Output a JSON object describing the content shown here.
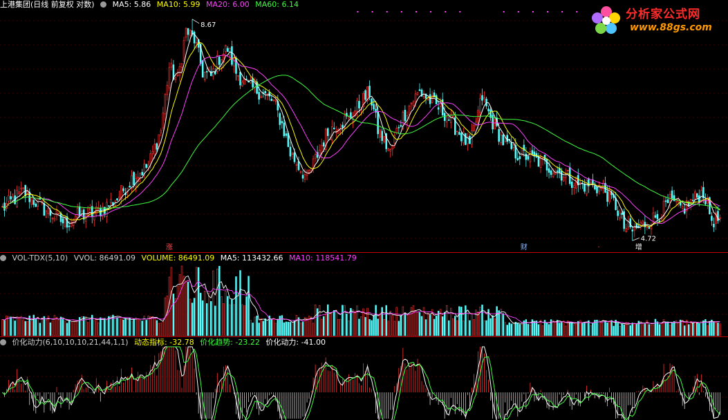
{
  "main": {
    "title": "上港集团(日线 前复权 对数)",
    "ma_labels": [
      {
        "text": "MA5: 5.86",
        "color": "#ffffff"
      },
      {
        "text": "MA10: 5.99",
        "color": "#ffff00"
      },
      {
        "text": "MA20: 6.00",
        "color": "#ff40ff"
      },
      {
        "text": "MA60: 6.14",
        "color": "#40ff40"
      }
    ],
    "high_label": "8.67",
    "low_label": "4.72",
    "markers": [
      {
        "text": "涨",
        "index": 80
      },
      {
        "text": "财",
        "index": 250
      },
      {
        "text": "",
        "index": 287
      },
      {
        "text": "增",
        "index": 305
      }
    ]
  },
  "volume": {
    "indicator": "VOL-TDX(5,10)",
    "labels": [
      {
        "text": "VVOL: 86491.09",
        "color": "#d0d0d0"
      },
      {
        "text": "VOLUME: 86491.09",
        "color": "#ffff00"
      },
      {
        "text": "MA5: 113432.66",
        "color": "#ffffff"
      },
      {
        "text": "MA10: 118541.79",
        "color": "#ff40ff"
      }
    ]
  },
  "momentum": {
    "indicator": "价化动力(6,10,10,10,21,44,1,1)",
    "labels": [
      {
        "text": "动态指标: -32.78",
        "color": "#ffff00"
      },
      {
        "text": "价化趋势: -23.22",
        "color": "#40ff40"
      },
      {
        "text": "价化动力: -41.00",
        "color": "#ffffff"
      }
    ]
  },
  "logo": {
    "name": "分析家公式网",
    "url": "www.88gs.com"
  },
  "colors": {
    "up": "#ff3232",
    "down": "#54fcfc",
    "ma5": "#ffffff",
    "ma10": "#ffff00",
    "ma20": "#ff40ff",
    "ma60": "#40ff40",
    "grid": "#8b0000"
  },
  "chart_data": {
    "type": "candlestick",
    "bars": 345,
    "price_range": [
      4.6,
      8.9
    ],
    "scale": "log",
    "price_anchors": [
      [
        0,
        5.15
      ],
      [
        10,
        5.4
      ],
      [
        20,
        5.15
      ],
      [
        30,
        4.95
      ],
      [
        35,
        5.05
      ],
      [
        45,
        5.1
      ],
      [
        55,
        5.3
      ],
      [
        62,
        5.6
      ],
      [
        70,
        5.8
      ],
      [
        76,
        6.4
      ],
      [
        80,
        7.6
      ],
      [
        84,
        7.3
      ],
      [
        88,
        8.4
      ],
      [
        92,
        8.2
      ],
      [
        96,
        7.5
      ],
      [
        100,
        7.4
      ],
      [
        104,
        7.8
      ],
      [
        108,
        8.0
      ],
      [
        112,
        7.5
      ],
      [
        118,
        7.2
      ],
      [
        124,
        7.1
      ],
      [
        130,
        6.9
      ],
      [
        134,
        6.5
      ],
      [
        138,
        6.0
      ],
      [
        142,
        5.8
      ],
      [
        146,
        5.6
      ],
      [
        150,
        5.9
      ],
      [
        155,
        6.3
      ],
      [
        160,
        6.5
      ],
      [
        166,
        6.6
      ],
      [
        172,
        6.9
      ],
      [
        176,
        7.1
      ],
      [
        180,
        6.4
      ],
      [
        186,
        6.0
      ],
      [
        190,
        6.5
      ],
      [
        196,
        6.9
      ],
      [
        200,
        7.1
      ],
      [
        206,
        6.9
      ],
      [
        212,
        6.7
      ],
      [
        218,
        6.4
      ],
      [
        224,
        6.1
      ],
      [
        230,
        7.0
      ],
      [
        234,
        6.6
      ],
      [
        240,
        6.2
      ],
      [
        246,
        6.0
      ],
      [
        252,
        5.95
      ],
      [
        258,
        5.85
      ],
      [
        264,
        5.75
      ],
      [
        270,
        5.65
      ],
      [
        276,
        5.5
      ],
      [
        282,
        5.5
      ],
      [
        288,
        5.45
      ],
      [
        294,
        5.2
      ],
      [
        298,
        4.9
      ],
      [
        302,
        4.85
      ],
      [
        308,
        4.95
      ],
      [
        314,
        5.05
      ],
      [
        320,
        5.25
      ],
      [
        326,
        5.15
      ],
      [
        332,
        5.3
      ],
      [
        336,
        5.4
      ],
      [
        340,
        5.0
      ],
      [
        344,
        5.0
      ]
    ],
    "high": {
      "index": 91,
      "value": 8.67
    },
    "low": {
      "index": 302,
      "value": 4.72
    }
  }
}
